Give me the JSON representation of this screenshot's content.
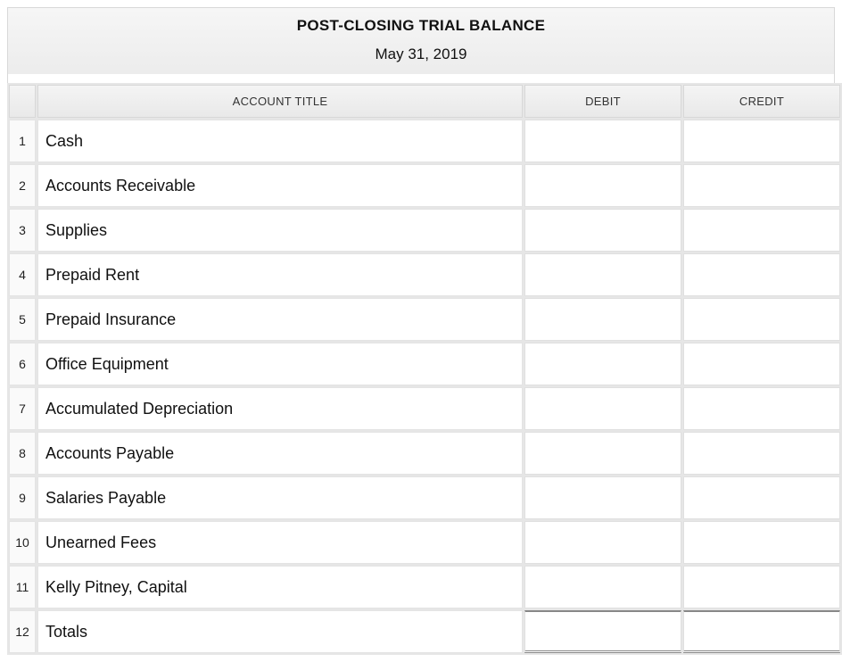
{
  "header": {
    "title": "POST-CLOSING TRIAL BALANCE",
    "date": "May 31, 2019"
  },
  "columns": {
    "account": "ACCOUNT TITLE",
    "debit": "DEBIT",
    "credit": "CREDIT"
  },
  "rows": [
    {
      "n": "1",
      "account": "Cash",
      "debit": "",
      "credit": ""
    },
    {
      "n": "2",
      "account": "Accounts Receivable",
      "debit": "",
      "credit": ""
    },
    {
      "n": "3",
      "account": "Supplies",
      "debit": "",
      "credit": ""
    },
    {
      "n": "4",
      "account": "Prepaid Rent",
      "debit": "",
      "credit": ""
    },
    {
      "n": "5",
      "account": "Prepaid Insurance",
      "debit": "",
      "credit": ""
    },
    {
      "n": "6",
      "account": "Office Equipment",
      "debit": "",
      "credit": ""
    },
    {
      "n": "7",
      "account": "Accumulated Depreciation",
      "debit": "",
      "credit": ""
    },
    {
      "n": "8",
      "account": "Accounts Payable",
      "debit": "",
      "credit": ""
    },
    {
      "n": "9",
      "account": "Salaries Payable",
      "debit": "",
      "credit": ""
    },
    {
      "n": "10",
      "account": "Unearned Fees",
      "debit": "",
      "credit": ""
    },
    {
      "n": "11",
      "account": "Kelly Pitney, Capital",
      "debit": "",
      "credit": ""
    },
    {
      "n": "12",
      "account": "Totals",
      "debit": "",
      "credit": "",
      "totals": true
    }
  ]
}
